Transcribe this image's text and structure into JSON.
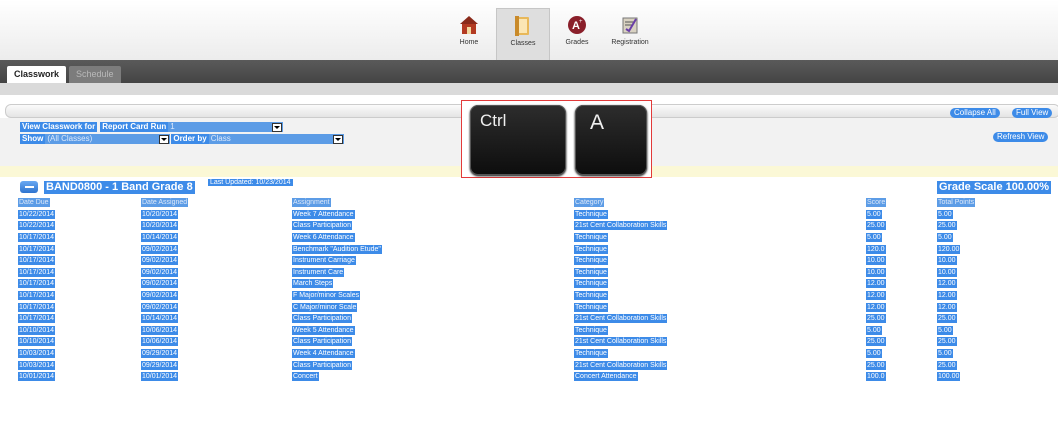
{
  "nav": {
    "items": [
      {
        "label": "Home",
        "icon": "home-icon"
      },
      {
        "label": "Classes",
        "icon": "classes-icon",
        "active": true
      },
      {
        "label": "Grades",
        "icon": "grades-icon"
      },
      {
        "label": "Registration",
        "icon": "registration-icon"
      }
    ]
  },
  "tabs": {
    "classwork": "Classwork",
    "schedule": "Schedule"
  },
  "toolbar": {
    "collapse_all": "Collapse All",
    "full_view": "Full View",
    "refresh_view": "Refresh View"
  },
  "filters": {
    "view_label": "View Classwork for",
    "run_label": "Report Card Run",
    "run_value": "1",
    "show_label": "Show",
    "show_value": "(All Classes)",
    "order_label": "Order by",
    "order_value": "Class"
  },
  "overlay": {
    "key1": "Ctrl",
    "key2": "A"
  },
  "class": {
    "title": "BAND0800 - 1 Band Grade 8",
    "last_updated": "Last Updated: 10/23/2014",
    "grade_scale": "Grade Scale 100.00%"
  },
  "table": {
    "columns": [
      "Date Due",
      "Date Assigned",
      "Assignment",
      "Category",
      "Score",
      "Total Points"
    ],
    "rows": [
      [
        "10/22/2014",
        "10/20/2014",
        "Week 7 Attendance",
        "Technique",
        "5.00",
        "5.00"
      ],
      [
        "10/22/2014",
        "10/20/2014",
        "Class Participation",
        "21st Cent Collaboration Skills",
        "25.00",
        "25.00"
      ],
      [
        "10/17/2014",
        "10/14/2014",
        "Week 6 Attendance",
        "Technique",
        "5.00",
        "5.00"
      ],
      [
        "10/17/2014",
        "09/02/2014",
        "Benchmark \"Audition Etude\"",
        "Technique",
        "120.0",
        "120.00"
      ],
      [
        "10/17/2014",
        "09/02/2014",
        "Instrument Carriage",
        "Technique",
        "10.00",
        "10.00"
      ],
      [
        "10/17/2014",
        "09/02/2014",
        "Instrument Care",
        "Technique",
        "10.00",
        "10.00"
      ],
      [
        "10/17/2014",
        "09/02/2014",
        "March Steps",
        "Technique",
        "12.00",
        "12.00"
      ],
      [
        "10/17/2014",
        "09/02/2014",
        "F Major/minor Scales",
        "Technique",
        "12.00",
        "12.00"
      ],
      [
        "10/17/2014",
        "09/02/2014",
        "C Major/minor Scale",
        "Technique",
        "12.00",
        "12.00"
      ],
      [
        "10/17/2014",
        "10/14/2014",
        "Class Participation",
        "21st Cent Collaboration Skills",
        "25.00",
        "25.00"
      ],
      [
        "10/10/2014",
        "10/06/2014",
        "Week 5 Attendance",
        "Technique",
        "5.00",
        "5.00"
      ],
      [
        "10/10/2014",
        "10/06/2014",
        "Class Participation",
        "21st Cent Collaboration Skills",
        "25.00",
        "25.00"
      ],
      [
        "10/03/2014",
        "09/29/2014",
        "Week 4 Attendance",
        "Technique",
        "5.00",
        "5.00"
      ],
      [
        "10/03/2014",
        "09/29/2014",
        "Class Participation",
        "21st Cent Collaboration Skills",
        "25.00",
        "25.00"
      ],
      [
        "10/01/2014",
        "10/01/2014",
        "Concert",
        "Concert Attendance",
        "100.0",
        "100.00"
      ]
    ]
  },
  "colors": {
    "selection": "#3d8be8",
    "accent_bar": "#444444",
    "highlight_row": "#fbf8d6",
    "overlay_border": "#e23a3a"
  }
}
